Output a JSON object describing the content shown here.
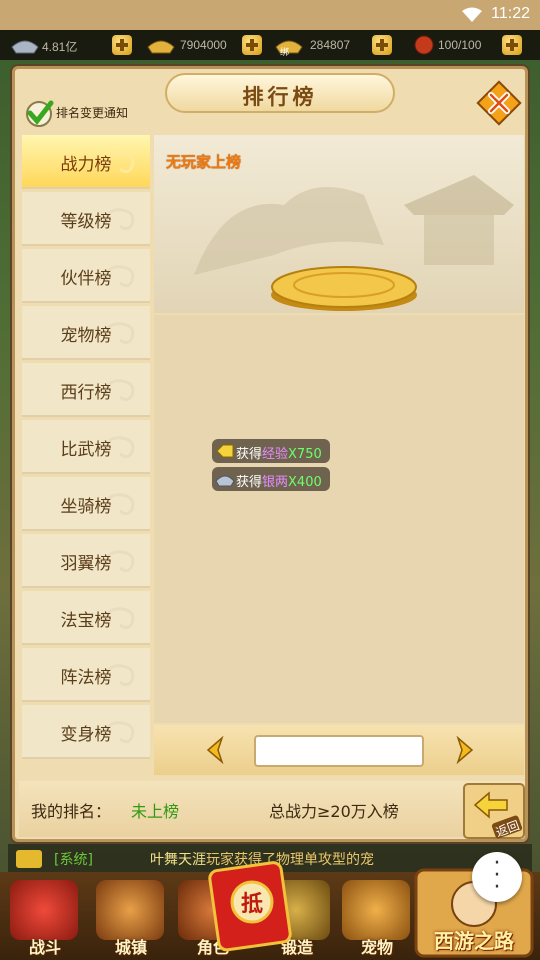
{
  "status_bar": {
    "time": "11:22"
  },
  "resources": [
    {
      "icon": "silver-ingot-icon",
      "value": "4.81亿"
    },
    {
      "icon": "gold-ingot-icon",
      "value": "7904000"
    },
    {
      "icon": "bound-gold-icon",
      "badge": "绑",
      "value": "284807"
    },
    {
      "icon": "stamina-icon",
      "value": "100/100"
    }
  ],
  "dialog": {
    "title": "排行榜",
    "notify_label": "排名变更通知"
  },
  "tabs": [
    {
      "label": "战力榜",
      "active": true
    },
    {
      "label": "等级榜"
    },
    {
      "label": "伙伴榜"
    },
    {
      "label": "宠物榜"
    },
    {
      "label": "西行榜"
    },
    {
      "label": "比武榜"
    },
    {
      "label": "坐骑榜"
    },
    {
      "label": "羽翼榜"
    },
    {
      "label": "法宝榜"
    },
    {
      "label": "阵法榜"
    },
    {
      "label": "变身榜"
    }
  ],
  "scene": {
    "empty_text": "无玩家上榜"
  },
  "rewards": [
    {
      "prefix": "获得",
      "item": "经验",
      "amount": "X750",
      "icon": "exp-icon"
    },
    {
      "prefix": "获得",
      "item": "银两",
      "amount": "X400",
      "icon": "silver-icon"
    }
  ],
  "pager": {
    "page_value": ""
  },
  "rank_bar": {
    "my_rank_label": "我的排名：",
    "my_rank_value": "未上榜",
    "requirement": "总战力≥20万入榜",
    "back_label": "返回"
  },
  "chat": {
    "channel": "[系统]",
    "player": "叶舞天涯",
    "message": "玩家获得了物理单攻型的宠"
  },
  "menu": [
    {
      "label": "战斗",
      "icon": "battle-icon"
    },
    {
      "label": "城镇",
      "icon": "town-icon"
    },
    {
      "label": "角色",
      "icon": "character-icon"
    },
    {
      "label": "锻造",
      "icon": "forge-icon"
    },
    {
      "label": "宠物",
      "icon": "pet-icon"
    }
  ],
  "logo_text": "西游之路",
  "red_packet_char": "抵",
  "colors": {
    "active_tab": "#ffd75a",
    "empty_text": "#f07a10",
    "rank_value": "#2f9a10",
    "reward_item": "#e58cff",
    "reward_amount": "#6dff6a"
  }
}
